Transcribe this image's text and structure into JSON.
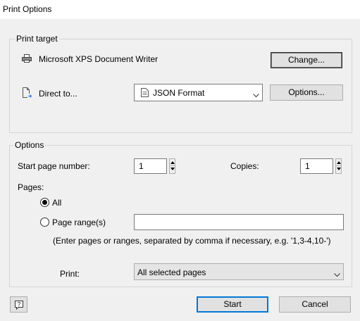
{
  "window": {
    "title": "Print Options"
  },
  "print_target": {
    "group_label": "Print target",
    "printer_icon": "printer-icon",
    "printer_name": "Microsoft XPS Document Writer",
    "change_button": "Change...",
    "direct_icon": "document-arrow-icon",
    "direct_label": "Direct to...",
    "format_icon": "document-icon",
    "format_value": "JSON Format",
    "options_button": "Options..."
  },
  "options": {
    "group_label": "Options",
    "start_page_label": "Start page number:",
    "start_page_value": "1",
    "copies_label": "Copies:",
    "copies_value": "1",
    "pages_label": "Pages:",
    "all_label": "All",
    "all_selected": true,
    "range_label": "Page range(s)",
    "range_value": "",
    "hint": "(Enter pages or ranges, separated by comma if necessary, e.g. '1,3-4,10-')",
    "print_label": "Print:",
    "print_value": "All selected pages"
  },
  "footer": {
    "help_icon": "help-icon",
    "start_button": "Start",
    "cancel_button": "Cancel"
  }
}
